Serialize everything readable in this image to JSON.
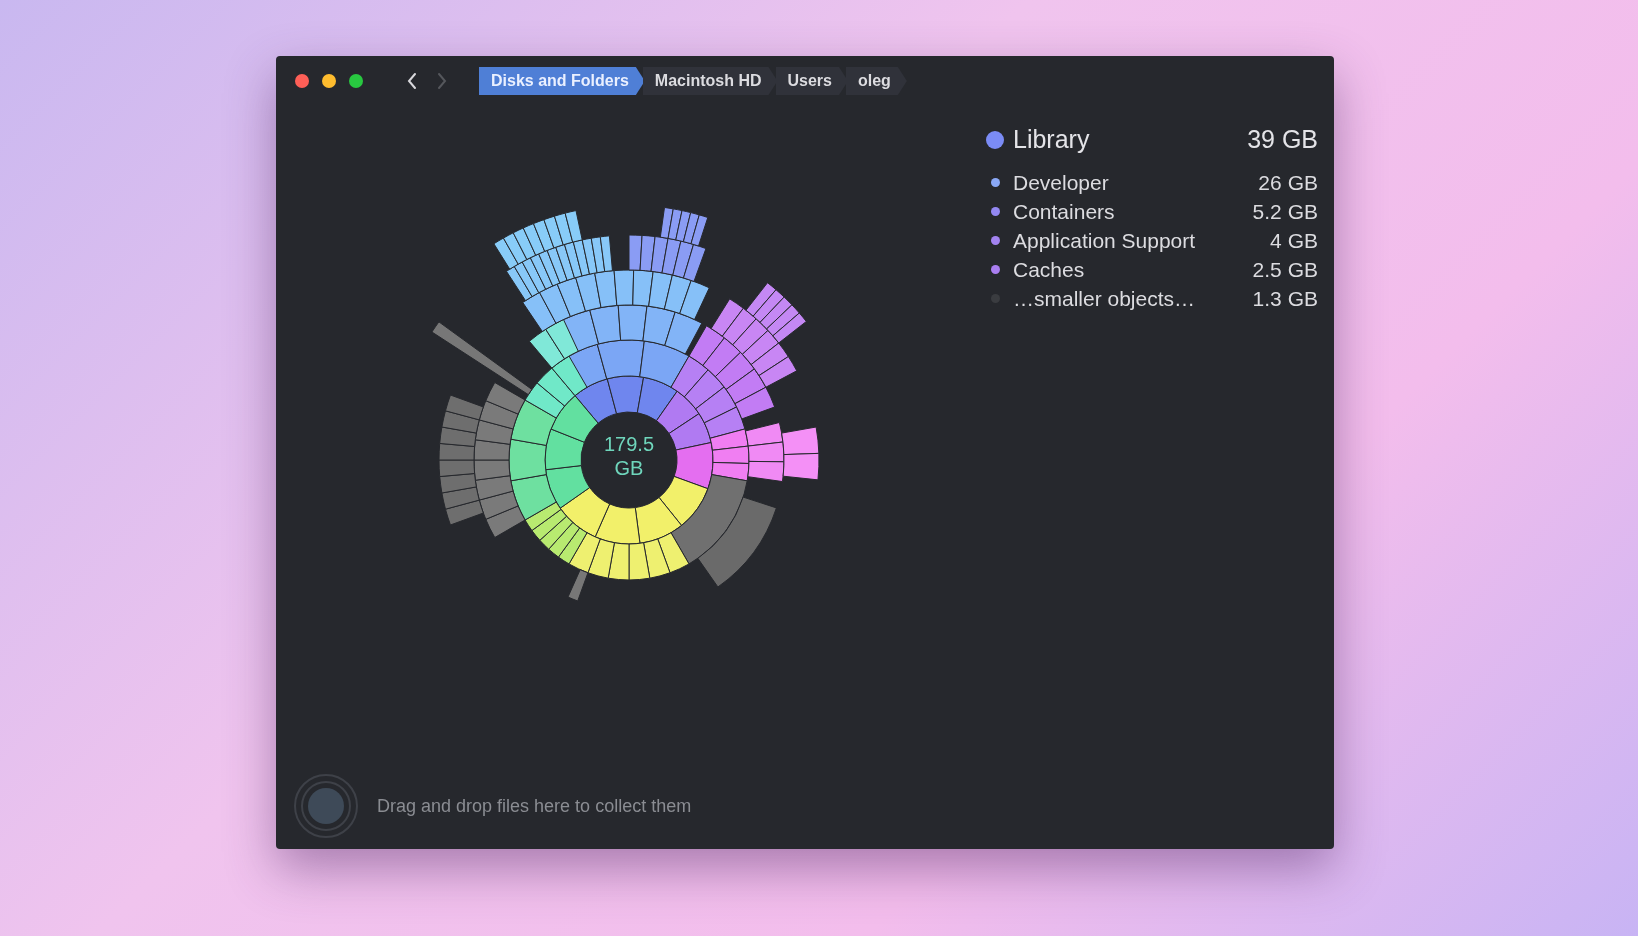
{
  "navigation": {
    "back_disabled": false,
    "forward_disabled": true
  },
  "breadcrumb": [
    {
      "label": "Disks and Folders",
      "selected": true
    },
    {
      "label": "Macintosh HD",
      "selected": false
    },
    {
      "label": "Users",
      "selected": false
    },
    {
      "label": "oleg",
      "selected": false
    }
  ],
  "chart": {
    "center_label": "179.5 GB"
  },
  "legend": {
    "header": {
      "name": "Library",
      "size": "39 GB",
      "color": "#7b8cf6"
    },
    "items": [
      {
        "name": "Developer",
        "value": "26",
        "unit": "GB",
        "color": "#8aa8f6"
      },
      {
        "name": "Containers",
        "value": "5.2",
        "unit": "GB",
        "color": "#9388f2"
      },
      {
        "name": "Application Support",
        "value": "4",
        "unit": "GB",
        "color": "#a283f0"
      },
      {
        "name": "Caches",
        "value": "2.5",
        "unit": "GB",
        "color": "#a97ef0"
      },
      {
        "name": "…smaller objects…",
        "value": "1.3",
        "unit": "GB",
        "color": "#3a3c40"
      }
    ]
  },
  "collector": {
    "hint": "Drag and drop files here to collect them"
  }
}
